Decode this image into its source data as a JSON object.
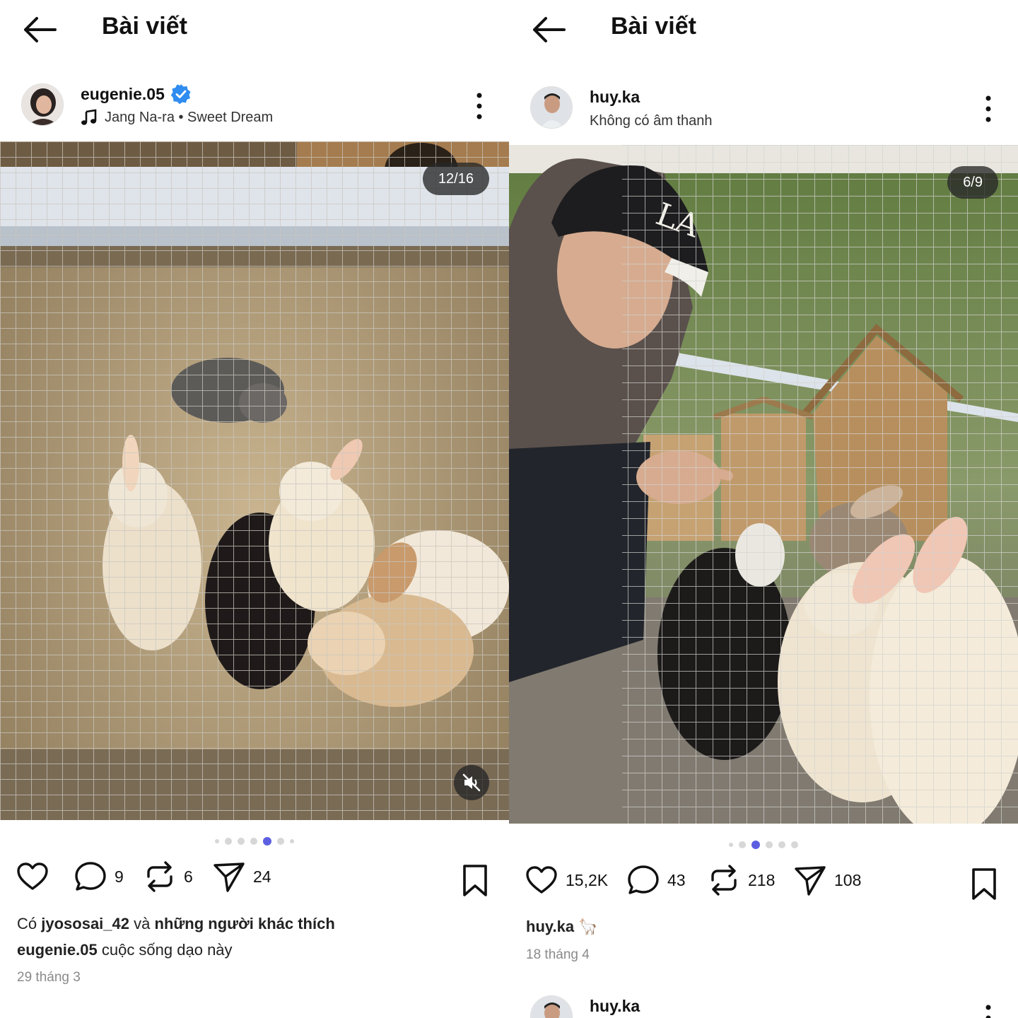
{
  "left": {
    "title": "Bài viết",
    "username": "eugenie.05",
    "music": "Jang Na-ra • Sweet Dream",
    "counter": "12/16",
    "likes": "",
    "comments": "9",
    "reposts": "6",
    "shares": "24",
    "liked_by_prefix": "Có",
    "liked_by_user": "jyososai_42",
    "liked_by_mid": "và",
    "liked_by_suffix": "những người khác thích",
    "caption_user": "eugenie.05",
    "caption_text": "cuộc sống dạo này",
    "date": "29 tháng 3",
    "carousel": {
      "count": 7,
      "active_index": 4
    }
  },
  "right": {
    "title": "Bài viết",
    "username": "huy.ka",
    "subtitle": "Không có âm thanh",
    "counter": "6/9",
    "likes": "15,2K",
    "comments": "43",
    "reposts": "218",
    "shares": "108",
    "caption_user": "huy.ka",
    "caption_emoji": "🦙",
    "date": "18 tháng 4",
    "next_username": "huy.ka",
    "carousel": {
      "count": 6,
      "active_index": 2
    }
  },
  "colors": {
    "accent_dot": "#5b5fe0",
    "verified": "#2f8cf0",
    "text_primary": "#111111",
    "text_muted": "#8a8a8a"
  },
  "icons": {
    "back": "arrow-left-icon",
    "verified": "verified-badge-icon",
    "music": "music-note-icon",
    "more": "more-vertical-icon",
    "like": "heart-icon",
    "comment": "comment-icon",
    "repost": "repost-icon",
    "share": "send-icon",
    "bookmark": "bookmark-icon",
    "mute": "speaker-muted-icon"
  }
}
